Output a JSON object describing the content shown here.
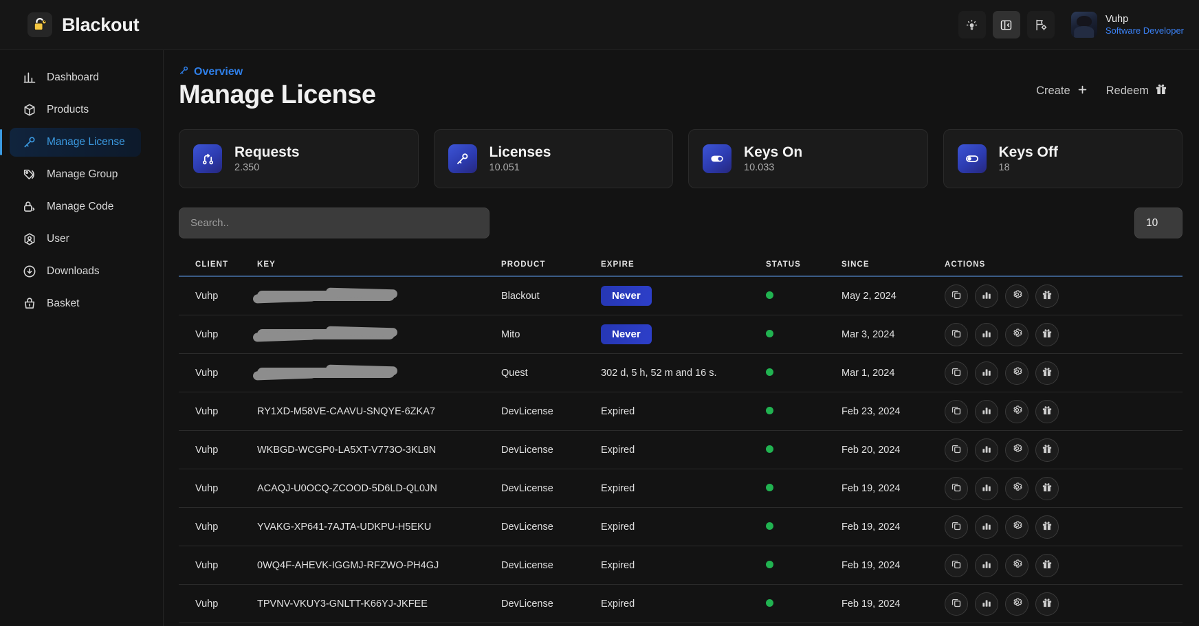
{
  "app": {
    "brand_name": "Blackout",
    "logo_icon": "padlock-icon"
  },
  "topbar": {
    "theme_icon": "lightbulb-icon",
    "panel_icon": "sidebar-toggle-icon",
    "language_icon": "flag-gear-icon",
    "profile": {
      "name": "Vuhp",
      "role": "Software Developer"
    }
  },
  "sidebar": {
    "items": [
      {
        "label": "Dashboard",
        "icon": "bar-chart-icon",
        "active": false
      },
      {
        "label": "Products",
        "icon": "box-icon",
        "active": false
      },
      {
        "label": "Manage License",
        "icon": "key-icon",
        "active": true
      },
      {
        "label": "Manage Group",
        "icon": "tags-icon",
        "active": false
      },
      {
        "label": "Manage Code",
        "icon": "lock-code-icon",
        "active": false
      },
      {
        "label": "User",
        "icon": "user-icon",
        "active": false
      },
      {
        "label": "Downloads",
        "icon": "download-icon",
        "active": false
      },
      {
        "label": "Basket",
        "icon": "basket-icon",
        "active": false
      }
    ]
  },
  "page": {
    "breadcrumb": "Overview",
    "breadcrumb_icon": "key-icon",
    "title": "Manage License",
    "actions": [
      {
        "label": "Create",
        "icon": "plus-icon"
      },
      {
        "label": "Redeem",
        "icon": "gift-icon"
      }
    ]
  },
  "stats": [
    {
      "title": "Requests",
      "value": "2.350",
      "icon": "git-pull-request-icon"
    },
    {
      "title": "Licenses",
      "value": "10.051",
      "icon": "key-icon"
    },
    {
      "title": "Keys On",
      "value": "10.033",
      "icon": "toggle-on-icon"
    },
    {
      "title": "Keys Off",
      "value": "18",
      "icon": "toggle-off-icon"
    }
  ],
  "toolbar": {
    "search_placeholder": "Search..",
    "search_value": "",
    "page_size": "10"
  },
  "table": {
    "columns": [
      "CLIENT",
      "KEY",
      "PRODUCT",
      "EXPIRE",
      "STATUS",
      "SINCE",
      "ACTIONS"
    ],
    "action_icons": [
      "copy-icon",
      "stats-icon",
      "gear-icon",
      "gift-icon"
    ],
    "rows": [
      {
        "client": "Vuhp",
        "key": "",
        "key_redacted": true,
        "product": "Blackout",
        "expire": "Never",
        "expire_badge": true,
        "status": "active",
        "since": "May 2, 2024"
      },
      {
        "client": "Vuhp",
        "key": "",
        "key_redacted": true,
        "product": "Mito",
        "expire": "Never",
        "expire_badge": true,
        "status": "active",
        "since": "Mar 3, 2024"
      },
      {
        "client": "Vuhp",
        "key": "",
        "key_redacted": true,
        "product": "Quest",
        "expire": "302 d, 5 h, 52 m and 16 s.",
        "expire_badge": false,
        "status": "active",
        "since": "Mar 1, 2024"
      },
      {
        "client": "Vuhp",
        "key": "RY1XD-M58VE-CAAVU-SNQYE-6ZKA7",
        "key_redacted": false,
        "product": "DevLicense",
        "expire": "Expired",
        "expire_badge": false,
        "status": "active",
        "since": "Feb 23, 2024"
      },
      {
        "client": "Vuhp",
        "key": "WKBGD-WCGP0-LA5XT-V773O-3KL8N",
        "key_redacted": false,
        "product": "DevLicense",
        "expire": "Expired",
        "expire_badge": false,
        "status": "active",
        "since": "Feb 20, 2024"
      },
      {
        "client": "Vuhp",
        "key": "ACAQJ-U0OCQ-ZCOOD-5D6LD-QL0JN",
        "key_redacted": false,
        "product": "DevLicense",
        "expire": "Expired",
        "expire_badge": false,
        "status": "active",
        "since": "Feb 19, 2024"
      },
      {
        "client": "Vuhp",
        "key": "YVAKG-XP641-7AJTA-UDKPU-H5EKU",
        "key_redacted": false,
        "product": "DevLicense",
        "expire": "Expired",
        "expire_badge": false,
        "status": "active",
        "since": "Feb 19, 2024"
      },
      {
        "client": "Vuhp",
        "key": "0WQ4F-AHEVK-IGGMJ-RFZWO-PH4GJ",
        "key_redacted": false,
        "product": "DevLicense",
        "expire": "Expired",
        "expire_badge": false,
        "status": "active",
        "since": "Feb 19, 2024"
      },
      {
        "client": "Vuhp",
        "key": "TPVNV-VKUY3-GNLTT-K66YJ-JKFEE",
        "key_redacted": false,
        "product": "DevLicense",
        "expire": "Expired",
        "expire_badge": false,
        "status": "active",
        "since": "Feb 19, 2024"
      }
    ]
  },
  "colors": {
    "accent_blue": "#3b82f6",
    "nav_active": "#3b9ae1",
    "badge_blue": "#2d3fc9",
    "status_green": "#21b351",
    "logo_yellow": "#f5c842"
  }
}
